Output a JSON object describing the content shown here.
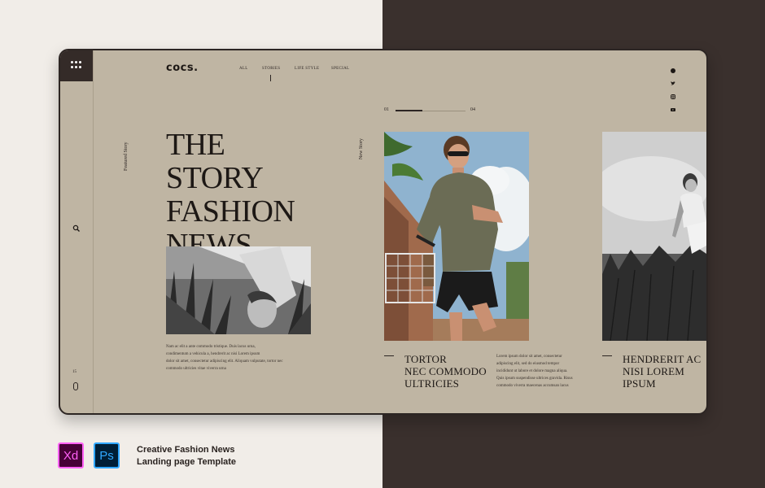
{
  "brand": {
    "logo": "cocs."
  },
  "nav": {
    "items": [
      {
        "label": "ALL"
      },
      {
        "label": "STORIES"
      },
      {
        "label": "LIFE STYLE"
      },
      {
        "label": "SPECIAL"
      }
    ]
  },
  "sidebar": {
    "featured_label": "Featured Story",
    "count": "15"
  },
  "hero": {
    "headline": [
      "THE",
      "STORY",
      "FASHION",
      "NEWS"
    ],
    "body": [
      "Nam ac elit a ante commodo tristique. Duis lacus urna,",
      "condimentum a vehicula a, hendrerit ac nisi Lorem ipsum",
      "dolor sit amet, consectetur adipiscing elit. Aliquam vulputate, tortor nec",
      "commodo ultricies vitae viverra urna"
    ]
  },
  "new_story": {
    "label": "New Story"
  },
  "pager": {
    "current": "01",
    "total": "04",
    "progress": 0.38
  },
  "stories": [
    {
      "title": [
        "TORTOR",
        "NEC COMMODO",
        "ULTRICIES"
      ],
      "body": [
        "Lorem ipsum dolor sit amet, consectetur",
        "adipiscing elit, sed do eiusmod tempor",
        "incididunt ut labore et dolore magna aliqua.",
        "Quis ipsum suspendisse ultrices gravida. Risus",
        "commodo viverra maecenas accumsan lacus"
      ]
    },
    {
      "title": [
        "HENDRERIT AC",
        "NISI LOREM",
        "IPSUM"
      ]
    }
  ],
  "social": [
    {
      "icon": "facebook-icon"
    },
    {
      "icon": "twitter-icon"
    },
    {
      "icon": "instagram-icon"
    },
    {
      "icon": "youtube-icon"
    }
  ],
  "promo": {
    "apps": [
      {
        "label": "Xd",
        "color": "#ff61f6",
        "bg": "#470137"
      },
      {
        "label": "Ps",
        "color": "#31a8ff",
        "bg": "#001e36"
      }
    ],
    "caption": [
      "Creative Fashion News",
      "Landing page Template"
    ]
  },
  "colors": {
    "screen_bg": "#bfb5a3",
    "dark": "#342b28",
    "page_left": "#f1ede8",
    "page_right": "#3a302d"
  }
}
